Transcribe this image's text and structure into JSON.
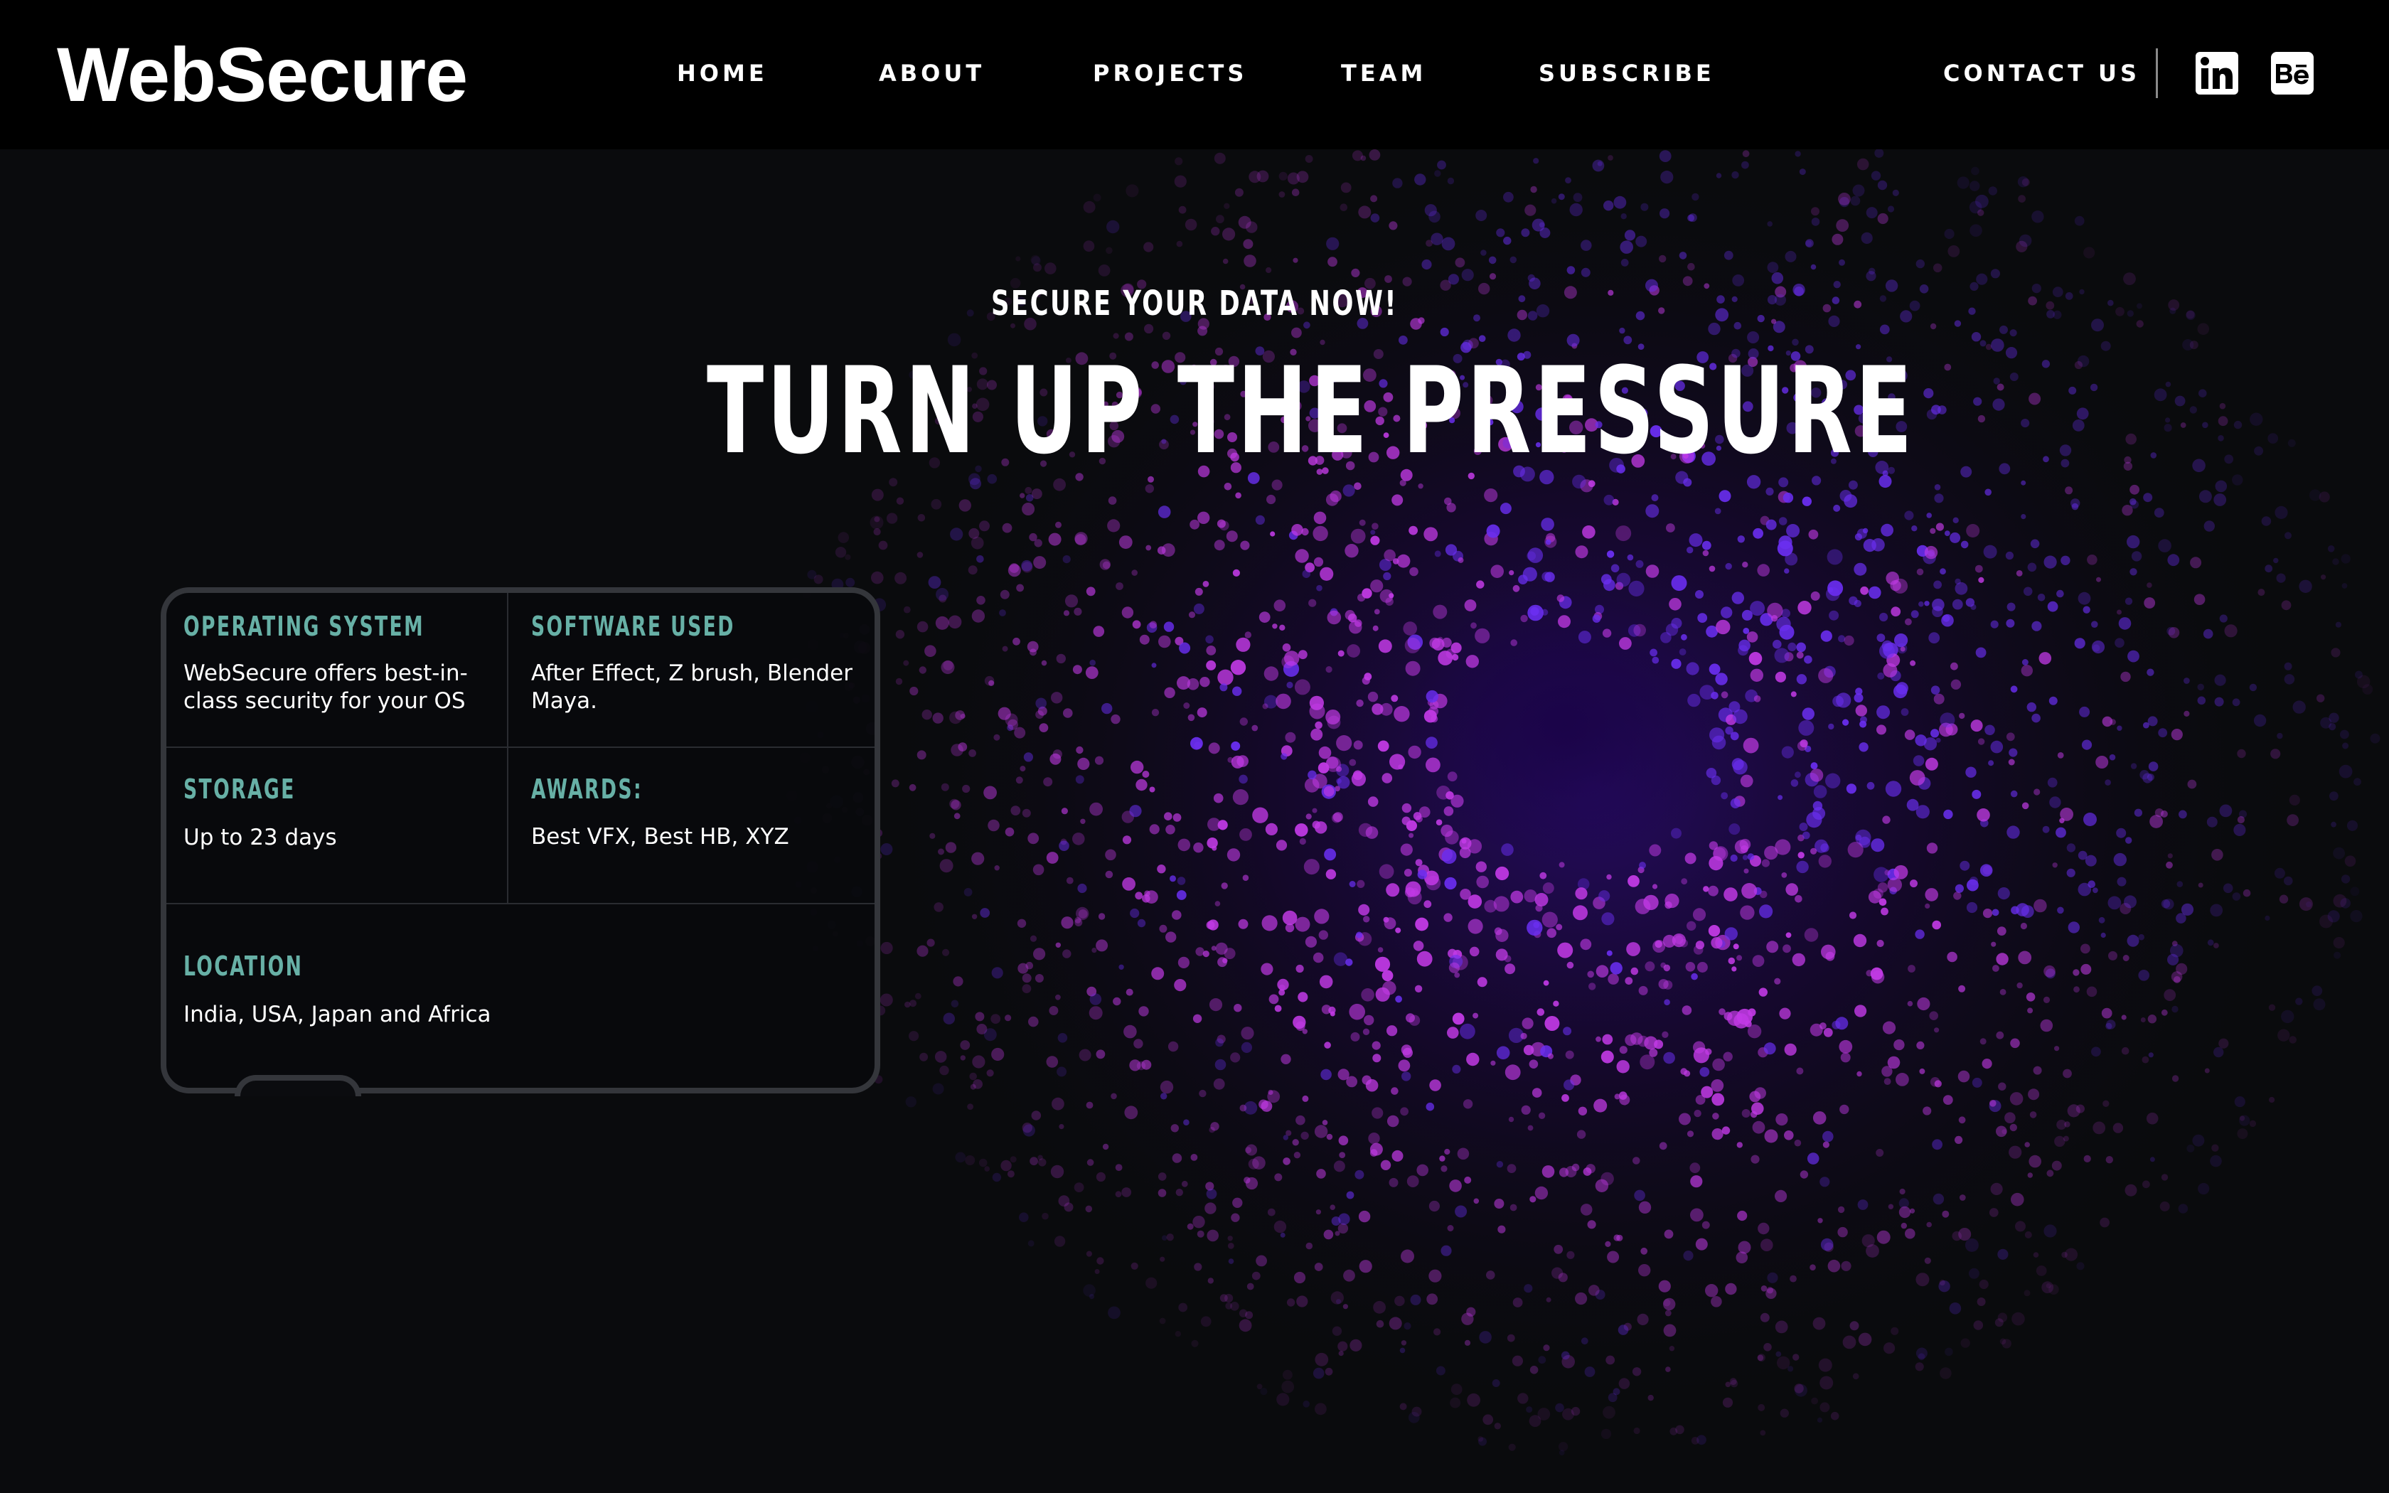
{
  "brand": {
    "logo_text": "WebSecure"
  },
  "nav": {
    "items": [
      {
        "label": "HOME"
      },
      {
        "label": "ABOUT"
      },
      {
        "label": "PROJECTS"
      },
      {
        "label": "TEAM"
      },
      {
        "label": "SUBSCRIBE"
      }
    ],
    "contact_label": "CONTACT US",
    "social": [
      {
        "icon": "linkedin-icon",
        "glyph": "in"
      },
      {
        "icon": "behance-icon",
        "glyph": "Bē"
      }
    ]
  },
  "hero": {
    "eyebrow": "SECURE YOUR DATA NOW!",
    "title": "TURN UP THE PRESSURE"
  },
  "info_card": {
    "cells": [
      {
        "label": "OPERATING SYSTEM",
        "text": "WebSecure offers best-in-class security for your OS"
      },
      {
        "label": "SOFTWARE USED",
        "text": "After Effect, Z brush, Blender Maya."
      },
      {
        "label": "STORAGE",
        "text": "Up to 23 days"
      },
      {
        "label": "AWARDS:",
        "text": "Best VFX, Best HB, XYZ"
      },
      {
        "label": "LOCATION",
        "text": "India, USA, Japan and Africa"
      }
    ]
  },
  "colors": {
    "background": "#0a0b0d",
    "header": "#000000",
    "label_teal": "#67b0a6",
    "card_border": "#34363b",
    "particle_magenta": "#c23ae6",
    "particle_violet": "#6a2ef0"
  }
}
